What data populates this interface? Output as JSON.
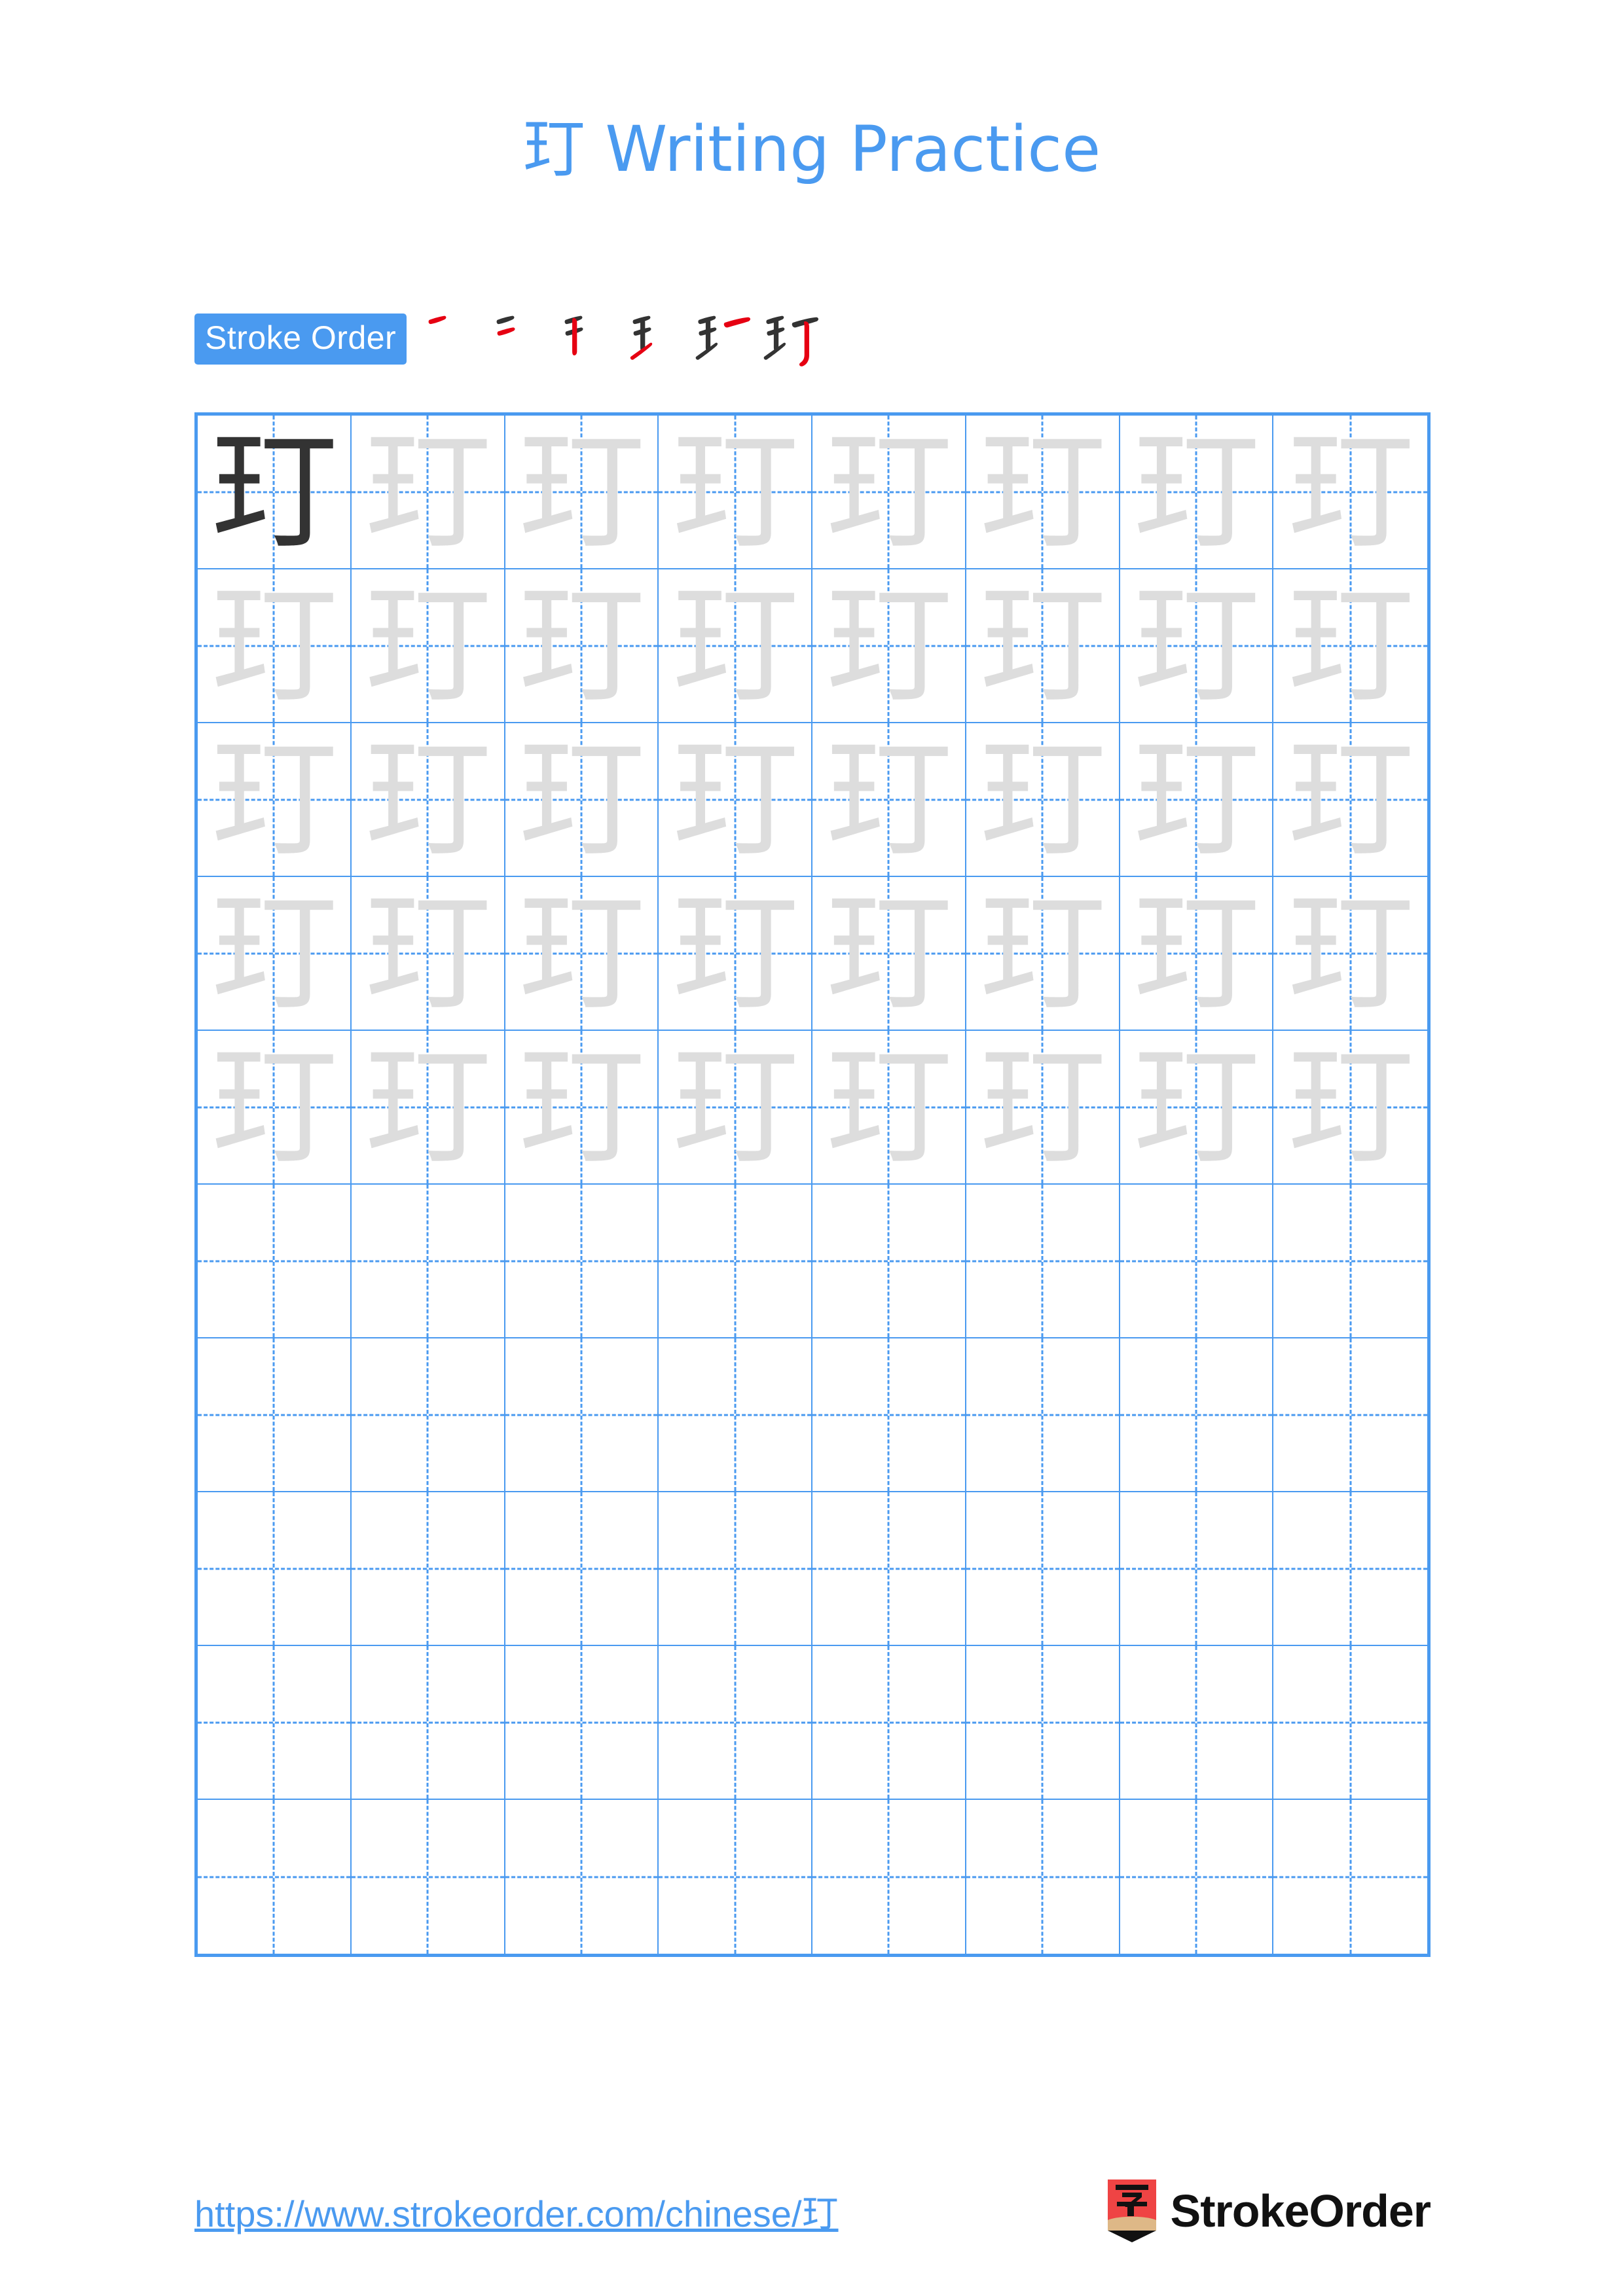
{
  "page": {
    "character": "玎",
    "title": "玎 Writing Practice",
    "title_suffix": " Writing Practice",
    "background_color": "#ffffff",
    "accent_color": "#4a9af0"
  },
  "stroke_order": {
    "label": "Stroke Order",
    "badge_background": "#4a9af0",
    "badge_text_color": "#ffffff",
    "new_stroke_color": "#e60012",
    "existing_stroke_color": "#333333",
    "total_strokes": 6,
    "frames": [
      {
        "index": 1,
        "strokes_shown": 1,
        "new_stroke": "héng (top-left short horizontal)"
      },
      {
        "index": 2,
        "strokes_shown": 2,
        "new_stroke": "héng (second short horizontal)"
      },
      {
        "index": 3,
        "strokes_shown": 3,
        "new_stroke": "shù (vertical)"
      },
      {
        "index": 4,
        "strokes_shown": 4,
        "new_stroke": "tí (rising stroke)"
      },
      {
        "index": 5,
        "strokes_shown": 5,
        "new_stroke": "héng (top horizontal of 丁)"
      },
      {
        "index": 6,
        "strokes_shown": 6,
        "new_stroke": "shùgōu (vertical hook)"
      }
    ]
  },
  "grid": {
    "columns": 8,
    "rows": 10,
    "border_color": "#4a9af0",
    "guide_color": "#4a9af0",
    "dark_char_color": "#333333",
    "light_char_color": "#dddddd",
    "cells": [
      [
        "dark",
        "light",
        "light",
        "light",
        "light",
        "light",
        "light",
        "light"
      ],
      [
        "light",
        "light",
        "light",
        "light",
        "light",
        "light",
        "light",
        "light"
      ],
      [
        "light",
        "light",
        "light",
        "light",
        "light",
        "light",
        "light",
        "light"
      ],
      [
        "light",
        "light",
        "light",
        "light",
        "light",
        "light",
        "light",
        "light"
      ],
      [
        "light",
        "light",
        "light",
        "light",
        "light",
        "light",
        "light",
        "light"
      ],
      [
        "empty",
        "empty",
        "empty",
        "empty",
        "empty",
        "empty",
        "empty",
        "empty"
      ],
      [
        "empty",
        "empty",
        "empty",
        "empty",
        "empty",
        "empty",
        "empty",
        "empty"
      ],
      [
        "empty",
        "empty",
        "empty",
        "empty",
        "empty",
        "empty",
        "empty",
        "empty"
      ],
      [
        "empty",
        "empty",
        "empty",
        "empty",
        "empty",
        "empty",
        "empty",
        "empty"
      ],
      [
        "empty",
        "empty",
        "empty",
        "empty",
        "empty",
        "empty",
        "empty",
        "empty"
      ]
    ]
  },
  "footer": {
    "url": "https://www.strokeorder.com/chinese/玎",
    "brand_name": "StrokeOrder",
    "logo_character": "字",
    "logo_body_color": "#ef4444",
    "logo_tip_color": "#deb887",
    "logo_point_color": "#111111"
  }
}
